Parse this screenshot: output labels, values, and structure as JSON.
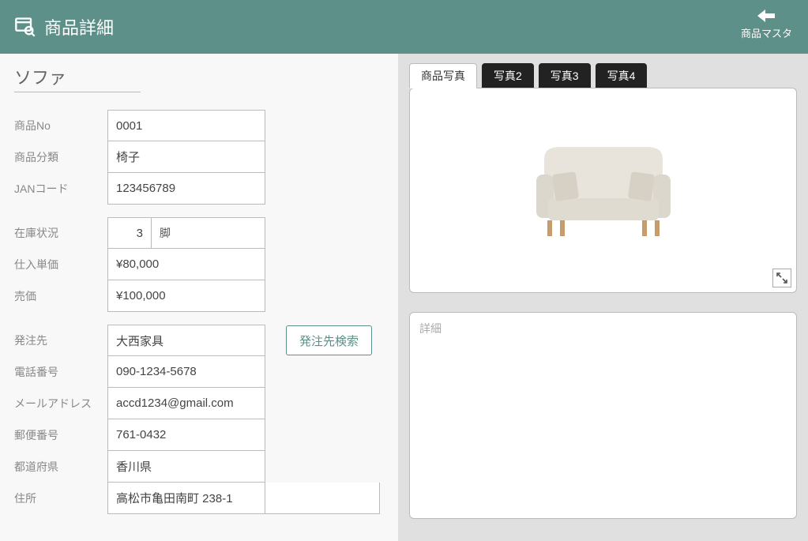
{
  "header": {
    "title": "商品詳細",
    "back_label": "商品マスタ"
  },
  "product": {
    "name": "ソファ"
  },
  "labels": {
    "product_no": "商品No",
    "category": "商品分類",
    "jan": "JANコード",
    "stock": "在庫状況",
    "stock_unit": "脚",
    "cost": "仕入単価",
    "price": "売価",
    "supplier": "発注先",
    "supplier_search": "発注先検索",
    "phone": "電話番号",
    "email": "メールアドレス",
    "postcode": "郵便番号",
    "prefecture": "都道府県",
    "address": "住所"
  },
  "values": {
    "product_no": "0001",
    "category": "椅子",
    "jan": "123456789",
    "stock_qty": "3",
    "cost": "¥80,000",
    "price": "¥100,000",
    "supplier": "大西家具",
    "phone": "090-1234-5678",
    "email": "accd1234@gmail.com",
    "postcode": "761-0432",
    "prefecture": "香川県",
    "address1": "高松市亀田南町 238-1",
    "address2": ""
  },
  "tabs": [
    "商品写真",
    "写真2",
    "写真3",
    "写真4"
  ],
  "detail_placeholder": "詳細"
}
